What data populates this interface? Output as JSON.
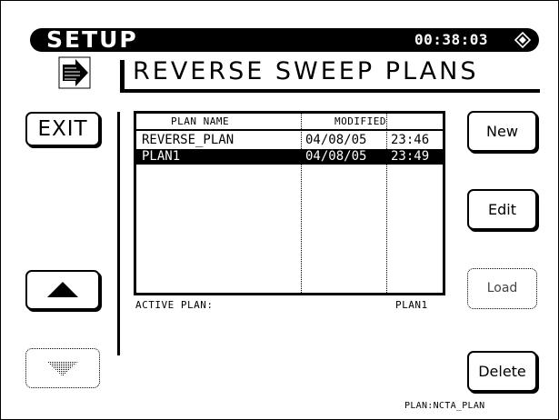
{
  "header": {
    "screen_title": "SETUP",
    "clock": "00:38:03",
    "page_title": "REVERSE SWEEP PLANS"
  },
  "buttons": {
    "exit": "EXIT",
    "new": "New",
    "edit": "Edit",
    "load": "Load",
    "delete": "Delete",
    "scroll_up_icon": "up-triangle-icon",
    "scroll_down_icon": "down-triangle-icon"
  },
  "table": {
    "columns": [
      "PLAN NAME",
      "MODIFIED"
    ],
    "rows": [
      {
        "name": "REVERSE_PLAN",
        "date": "04/08/05",
        "time": "23:46",
        "selected": false
      },
      {
        "name": "PLAN1",
        "date": "04/08/05",
        "time": "23:49",
        "selected": true
      }
    ]
  },
  "active_plan": {
    "label": "ACTIVE PLAN:",
    "value": "PLAN1"
  },
  "footer": {
    "plan": "PLAN:NCTA_PLAN"
  },
  "icons": {
    "clock": "diamond-clock-icon",
    "nav": "arrow-right-icon"
  },
  "colors": {
    "foreground": "#000000",
    "background": "#ffffff"
  }
}
